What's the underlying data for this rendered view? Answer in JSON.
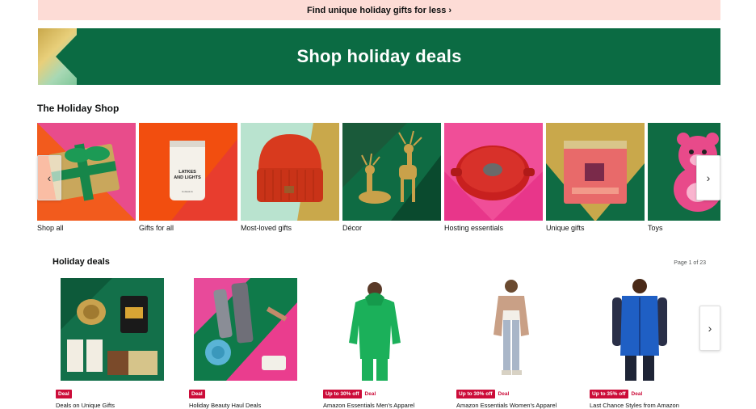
{
  "banner": {
    "text": "Find unique holiday gifts for less ›"
  },
  "hero": {
    "title": "Shop holiday deals"
  },
  "holiday_shop": {
    "title": "The Holiday Shop",
    "tiles": [
      {
        "label": "Shop all"
      },
      {
        "label": "Gifts for all"
      },
      {
        "label": "Most-loved gifts"
      },
      {
        "label": "Décor"
      },
      {
        "label": "Hosting essentials"
      },
      {
        "label": "Unique gifts"
      },
      {
        "label": "Toys"
      }
    ],
    "candle_text": "LATKES AND LIGHTS",
    "prev_label": "‹",
    "next_label": "›"
  },
  "holiday_deals": {
    "title": "Holiday deals",
    "page_indicator": "Page 1 of 23",
    "next_label": "›",
    "items": [
      {
        "badge": "Deal",
        "extra": "",
        "name": "Deals on Unique Gifts"
      },
      {
        "badge": "Deal",
        "extra": "",
        "name": "Holiday Beauty Haul Deals"
      },
      {
        "badge": "Up to 30% off",
        "extra": "Deal",
        "name": "Amazon Essentials Men's Apparel"
      },
      {
        "badge": "Up to 30% off",
        "extra": "Deal",
        "name": "Amazon Essentials Women's Apparel"
      },
      {
        "badge": "Up to 35% off",
        "extra": "Deal",
        "name": "Last Chance Styles from Amazon"
      }
    ]
  },
  "colors": {
    "deal_red": "#cc0c39",
    "hero_green": "#0b6b43",
    "banner_pink": "#fddcd6"
  }
}
